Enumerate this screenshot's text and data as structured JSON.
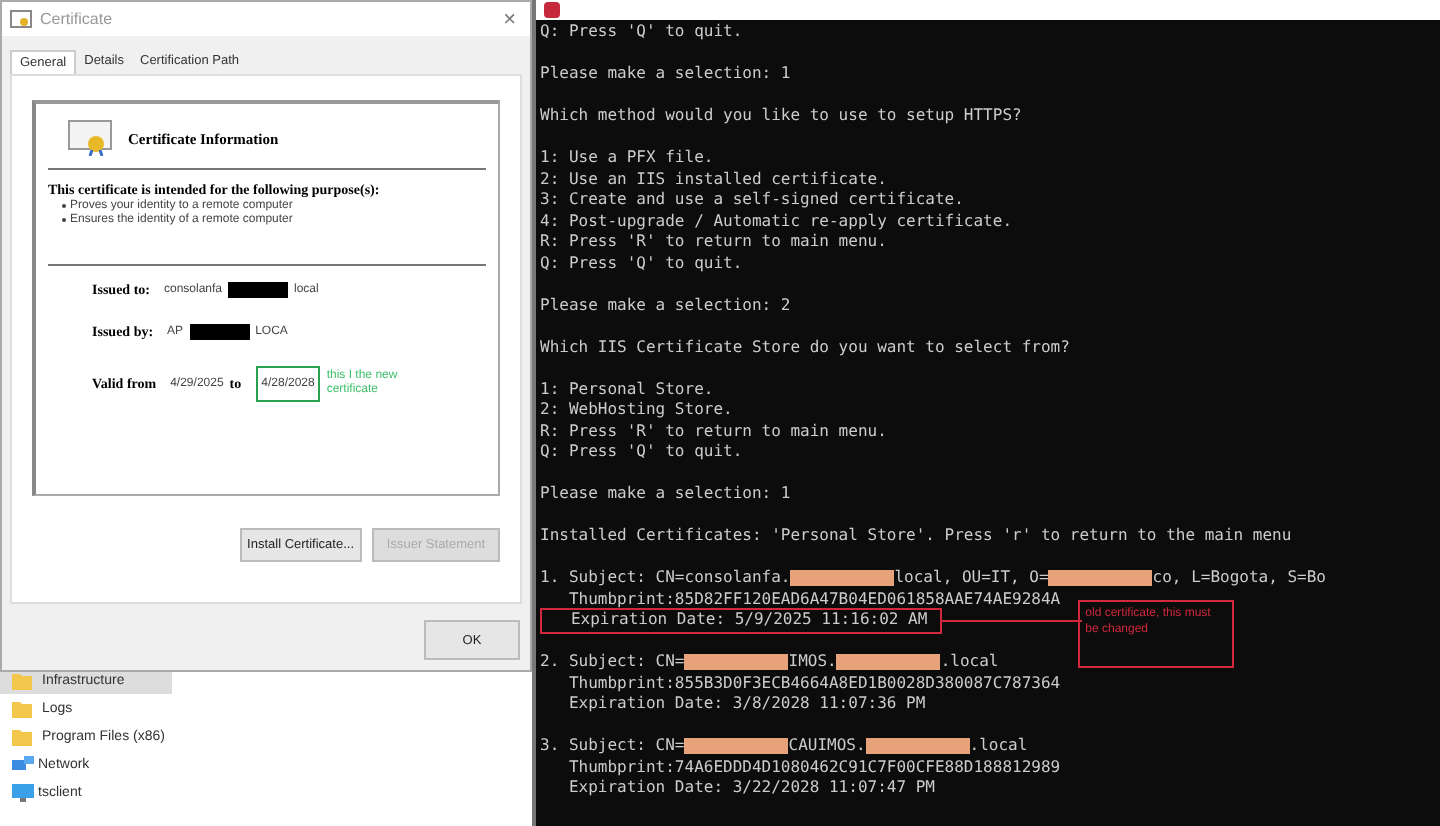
{
  "dialog": {
    "title": "Certificate",
    "close": "×",
    "tabs": [
      {
        "label": "General",
        "selected": true
      },
      {
        "label": "Details",
        "selected": false
      },
      {
        "label": "Certification Path",
        "selected": false
      }
    ],
    "heading": "Certificate Information",
    "purpose": "This certificate is intended for the following purpose(s):",
    "bullets": [
      "Proves your identity to a remote computer",
      "Ensures the identity of a remote computer"
    ],
    "issued_to": {
      "label": "Issued to:",
      "parts": [
        {
          "kind": "text",
          "text": "consolanfa"
        },
        {
          "kind": "redacted"
        },
        {
          "kind": "text",
          "text": "local"
        }
      ]
    },
    "issued_by": {
      "label": "Issued by:",
      "parts": [
        {
          "kind": "text",
          "text": "AP"
        },
        {
          "kind": "redacted"
        },
        {
          "kind": "text",
          "text": "LOCA"
        }
      ]
    },
    "valid": {
      "label": "Valid from",
      "from": "4/29/2025",
      "to_label": "to",
      "to": "4/28/2028"
    },
    "note": "this I the new certificate",
    "buttons": [
      {
        "label": "Install Certificate...",
        "disabled": false
      },
      {
        "label": "Issuer Statement",
        "disabled": true
      }
    ],
    "ok": "OK"
  },
  "explorer": [
    {
      "label": "Infrastructure",
      "kind": "folder",
      "selected": true
    },
    {
      "label": "Logs",
      "kind": "folder",
      "selected": false
    },
    {
      "label": "Program Files (x86)",
      "kind": "folder",
      "selected": false
    },
    {
      "label": "Network",
      "kind": "network",
      "selected": false
    },
    {
      "label": "tsclient",
      "kind": "computer",
      "selected": false
    }
  ],
  "console": {
    "blocks": [
      [
        [
          {
            "kind": "text",
            "text": "Q: Press 'Q' to quit."
          }
        ]
      ],
      [
        [
          {
            "kind": "text",
            "text": "Please make a selection: 1"
          }
        ]
      ],
      [
        [
          {
            "kind": "text",
            "text": "Which method would you like to use to setup HTTPS?"
          }
        ]
      ],
      [
        [
          {
            "kind": "text",
            "text": "1: Use a PFX file."
          }
        ],
        [
          {
            "kind": "text",
            "text": "2: Use an IIS installed certificate."
          }
        ],
        [
          {
            "kind": "text",
            "text": "3: Create and use a self-signed certificate."
          }
        ],
        [
          {
            "kind": "text",
            "text": "4: Post-upgrade / Automatic re-apply certificate."
          }
        ],
        [
          {
            "kind": "text",
            "text": "R: Press 'R' to return to main menu."
          }
        ],
        [
          {
            "kind": "text",
            "text": "Q: Press 'Q' to quit."
          }
        ]
      ],
      [
        [
          {
            "kind": "text",
            "text": "Please make a selection: 2"
          }
        ]
      ],
      [
        [
          {
            "kind": "text",
            "text": "Which IIS Certificate Store do you want to select from?"
          }
        ]
      ],
      [
        [
          {
            "kind": "text",
            "text": "1: Personal Store."
          }
        ],
        [
          {
            "kind": "text",
            "text": "2: WebHosting Store."
          }
        ],
        [
          {
            "kind": "text",
            "text": "R: Press 'R' to return to main menu."
          }
        ],
        [
          {
            "kind": "text",
            "text": "Q: Press 'Q' to quit."
          }
        ]
      ],
      [
        [
          {
            "kind": "text",
            "text": "Please make a selection: 1"
          }
        ]
      ],
      [
        [
          {
            "kind": "text",
            "text": "Installed Certificates: 'Personal Store'. Press 'r' to return to the main menu"
          }
        ]
      ],
      [
        [
          {
            "kind": "text",
            "text": "1. Subject: CN=consolanfa."
          },
          {
            "kind": "redacted"
          },
          {
            "kind": "text",
            "text": "local, OU=IT, O="
          },
          {
            "kind": "redacted"
          },
          {
            "kind": "text",
            "text": "co, L=Bogota, S=Bo"
          }
        ],
        [
          {
            "kind": "text",
            "text": "   Thumbprint:85D82FF120EAD6A47B04ED061858AAE74AE9284A"
          }
        ],
        [
          {
            "kind": "flagged",
            "text": "   Expiration Date: 5/9/2025 11:16:02 AM"
          }
        ]
      ],
      [
        [
          {
            "kind": "text",
            "text": "2. Subject: CN="
          },
          {
            "kind": "redacted"
          },
          {
            "kind": "text",
            "text": "IMOS."
          },
          {
            "kind": "redacted"
          },
          {
            "kind": "text",
            "text": ".local"
          }
        ],
        [
          {
            "kind": "text",
            "text": "   Thumbprint:855B3D0F3ECB4664A8ED1B0028D380087C787364"
          }
        ],
        [
          {
            "kind": "text",
            "text": "   Expiration Date: 3/8/2028 11:07:36 PM"
          }
        ]
      ],
      [
        [
          {
            "kind": "text",
            "text": "3. Subject: CN="
          },
          {
            "kind": "redacted"
          },
          {
            "kind": "text",
            "text": "CAUIMOS."
          },
          {
            "kind": "redacted"
          },
          {
            "kind": "text",
            "text": ".local"
          }
        ],
        [
          {
            "kind": "text",
            "text": "   Thumbprint:74A6EDDD4D1080462C91C7F00CFE88D188812989"
          }
        ],
        [
          {
            "kind": "text",
            "text": "   Expiration Date: 3/22/2028 11:07:47 PM"
          }
        ]
      ]
    ],
    "note": "old certificate, this must be changed"
  }
}
